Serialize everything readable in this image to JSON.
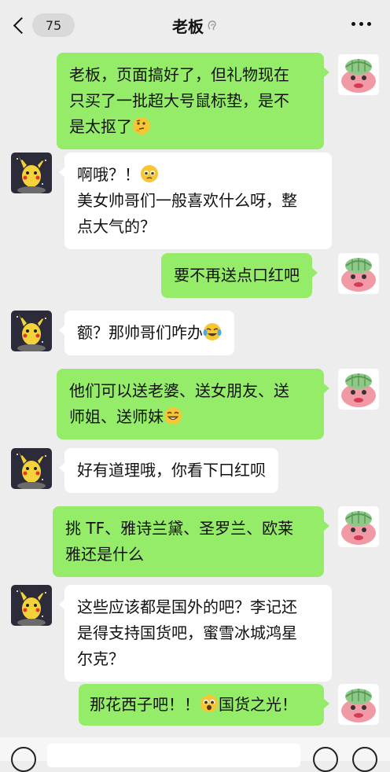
{
  "header": {
    "back_count": "75",
    "title": "老板"
  },
  "messages": [
    {
      "from": "me",
      "lines": [
        "老板，页面搞好了，但礼物现在",
        "只买了一批超大号鼠标垫，是不",
        "是太抠了"
      ]
    },
    {
      "from": "other",
      "lines": [
        "啊哦？！",
        "美女帅哥们一般喜欢什么呀，整",
        "点大气的？"
      ]
    },
    {
      "from": "me",
      "lines": [
        "要不再送点口红吧"
      ]
    },
    {
      "from": "other",
      "lines": [
        "额？那帅哥们咋办"
      ]
    },
    {
      "from": "me",
      "lines": [
        "他们可以送老婆、送女朋友、送",
        "师姐、送师妹"
      ]
    },
    {
      "from": "other",
      "lines": [
        "好有道理哦，你看下口红呗"
      ]
    },
    {
      "from": "me",
      "lines": [
        "挑 TF、雅诗兰黛、圣罗兰、欧莱",
        "雅还是什么"
      ]
    },
    {
      "from": "other",
      "lines": [
        "这些应该都是国外的吧？李记还",
        "是得支持国货吧，蜜雪冰城鸿星",
        "尔克？"
      ]
    },
    {
      "from": "me",
      "lines": [
        "那花西子吧！！",
        "国货之光！"
      ]
    }
  ],
  "colors": {
    "background": "#ededed",
    "my_bubble": "#95ec69",
    "other_bubble": "#ffffff"
  }
}
